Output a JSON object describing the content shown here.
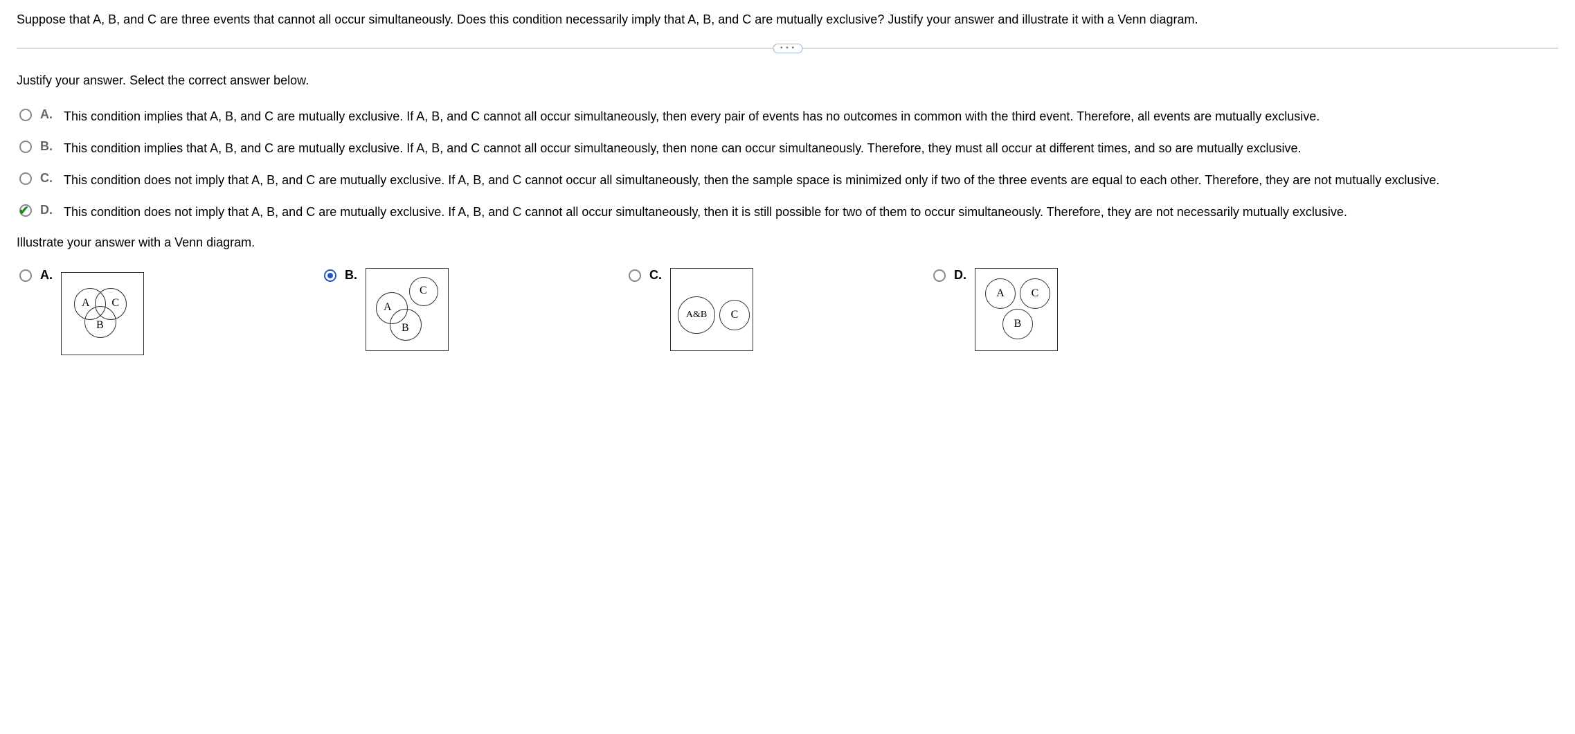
{
  "question": "Suppose that A, B, and C are three events that cannot all occur simultaneously. Does this condition necessarily imply that A, B, and C are mutually exclusive? Justify your answer and illustrate it with a Venn diagram.",
  "divider": {
    "dots": "• • •"
  },
  "justify_instruction": "Justify your answer. Select the correct answer below.",
  "options": {
    "A": {
      "letter": "A.",
      "text": "This condition implies that A, B, and C are mutually exclusive. If A, B, and C cannot all occur simultaneously, then every pair of events has no outcomes in common with the third event. Therefore, all events are mutually exclusive."
    },
    "B": {
      "letter": "B.",
      "text": "This condition implies that A, B, and C are mutually exclusive. If A, B, and C cannot all occur simultaneously, then none can occur simultaneously. Therefore, they must all occur at different times, and so are mutually exclusive."
    },
    "C": {
      "letter": "C.",
      "text": "This condition does not imply that A, B, and C are mutually exclusive. If A, B, and C cannot occur all simultaneously, then the sample space is minimized only if two of the three events are equal to each other. Therefore, they are not mutually exclusive."
    },
    "D": {
      "letter": "D.",
      "text": "This condition does not imply that A, B, and C are mutually exclusive. If A, B, and C cannot all occur simultaneously, then it is still possible for two of them to occur simultaneously. Therefore, they are not necessarily mutually exclusive."
    }
  },
  "venn_instruction": "Illustrate your answer with a Venn diagram.",
  "venn": {
    "A": {
      "letter": "A.",
      "labels": {
        "A": "A",
        "B": "B",
        "C": "C"
      }
    },
    "B": {
      "letter": "B.",
      "labels": {
        "A": "A",
        "B": "B",
        "C": "C"
      }
    },
    "C": {
      "letter": "C.",
      "labels": {
        "AB": "A&B",
        "C": "C"
      }
    },
    "D": {
      "letter": "D.",
      "labels": {
        "A": "A",
        "B": "B",
        "C": "C"
      }
    }
  }
}
